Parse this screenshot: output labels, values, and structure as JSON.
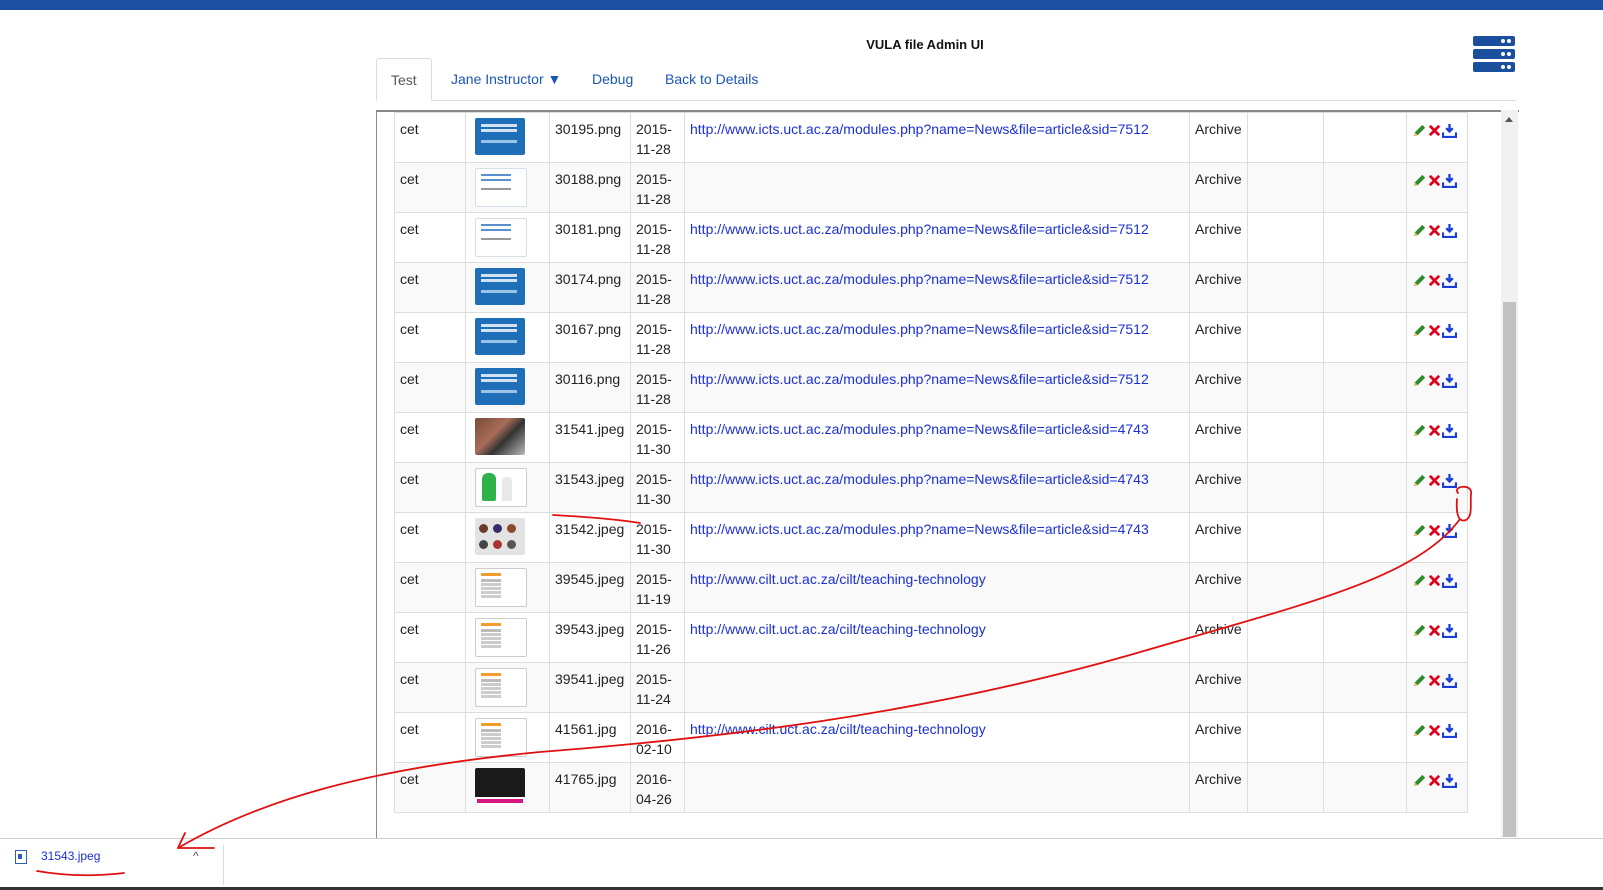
{
  "app": {
    "title": "VULA file Admin UI"
  },
  "tabs": [
    {
      "label": "Test",
      "active": true
    },
    {
      "label": "Jane Instructor ▼",
      "active": false
    },
    {
      "label": "Debug",
      "active": false
    },
    {
      "label": "Back to Details",
      "active": false
    }
  ],
  "table": {
    "stub": {
      "date": "11-28"
    },
    "rows": [
      {
        "site": "cet",
        "thumb": "blue",
        "file": "30195.png",
        "date1": "2015-",
        "date2": "11-28",
        "url": "http://www.icts.uct.ac.za/modules.php?name=News&file=article&sid=7512",
        "status": "Archive"
      },
      {
        "site": "cet",
        "thumb": "white",
        "file": "30188.png",
        "date1": "2015-",
        "date2": "11-28",
        "url": "",
        "status": "Archive"
      },
      {
        "site": "cet",
        "thumb": "white",
        "file": "30181.png",
        "date1": "2015-",
        "date2": "11-28",
        "url": "http://www.icts.uct.ac.za/modules.php?name=News&file=article&sid=7512",
        "status": "Archive"
      },
      {
        "site": "cet",
        "thumb": "blue",
        "file": "30174.png",
        "date1": "2015-",
        "date2": "11-28",
        "url": "http://www.icts.uct.ac.za/modules.php?name=News&file=article&sid=7512",
        "status": "Archive"
      },
      {
        "site": "cet",
        "thumb": "blue",
        "file": "30167.png",
        "date1": "2015-",
        "date2": "11-28",
        "url": "http://www.icts.uct.ac.za/modules.php?name=News&file=article&sid=7512",
        "status": "Archive"
      },
      {
        "site": "cet",
        "thumb": "blue",
        "file": "30116.png",
        "date1": "2015-",
        "date2": "11-28",
        "url": "http://www.icts.uct.ac.za/modules.php?name=News&file=article&sid=7512",
        "status": "Archive"
      },
      {
        "site": "cet",
        "thumb": "photo",
        "file": "31541.jpeg",
        "date1": "2015-",
        "date2": "11-30",
        "url": "http://www.icts.uct.ac.za/modules.php?name=News&file=article&sid=4743",
        "status": "Archive"
      },
      {
        "site": "cet",
        "thumb": "cartoon",
        "file": "31543.jpeg",
        "date1": "2015-",
        "date2": "11-30",
        "url": "http://www.icts.uct.ac.za/modules.php?name=News&file=article&sid=4743",
        "status": "Archive"
      },
      {
        "site": "cet",
        "thumb": "collage",
        "file": "31542.jpeg",
        "date1": "2015-",
        "date2": "11-30",
        "url": "http://www.icts.uct.ac.za/modules.php?name=News&file=article&sid=4743",
        "status": "Archive"
      },
      {
        "site": "cet",
        "thumb": "doc",
        "file": "39545.jpeg",
        "date1": "2015-",
        "date2": "11-19",
        "url": "http://www.cilt.uct.ac.za/cilt/teaching-technology",
        "status": "Archive"
      },
      {
        "site": "cet",
        "thumb": "doc",
        "file": "39543.jpeg",
        "date1": "2015-",
        "date2": "11-26",
        "url": "http://www.cilt.uct.ac.za/cilt/teaching-technology",
        "status": "Archive"
      },
      {
        "site": "cet",
        "thumb": "doc",
        "file": "39541.jpeg",
        "date1": "2015-",
        "date2": "11-24",
        "url": "",
        "status": "Archive"
      },
      {
        "site": "cet",
        "thumb": "doc",
        "file": "41561.jpg",
        "date1": "2016-",
        "date2": "02-10",
        "url": "http://www.cilt.uct.ac.za/cilt/teaching-technology",
        "status": "Archive"
      },
      {
        "site": "cet",
        "thumb": "dark",
        "file": "41765.jpg",
        "date1": "2016-",
        "date2": "04-26",
        "url": "",
        "status": "Archive"
      }
    ]
  },
  "download_bar": {
    "filename": "31543.jpeg",
    "chevron": "^"
  },
  "colors": {
    "brand": "#1f4fa3",
    "link": "#1a2fd6",
    "edit": "#2e8b2e",
    "delete": "#e0001b",
    "download": "#1a3fd6",
    "annotation": "#e01010"
  },
  "icons": [
    "menu-icon",
    "edit-icon",
    "delete-icon",
    "download-icon",
    "file-icon",
    "chevron-up-icon",
    "scroll-up-icon"
  ]
}
